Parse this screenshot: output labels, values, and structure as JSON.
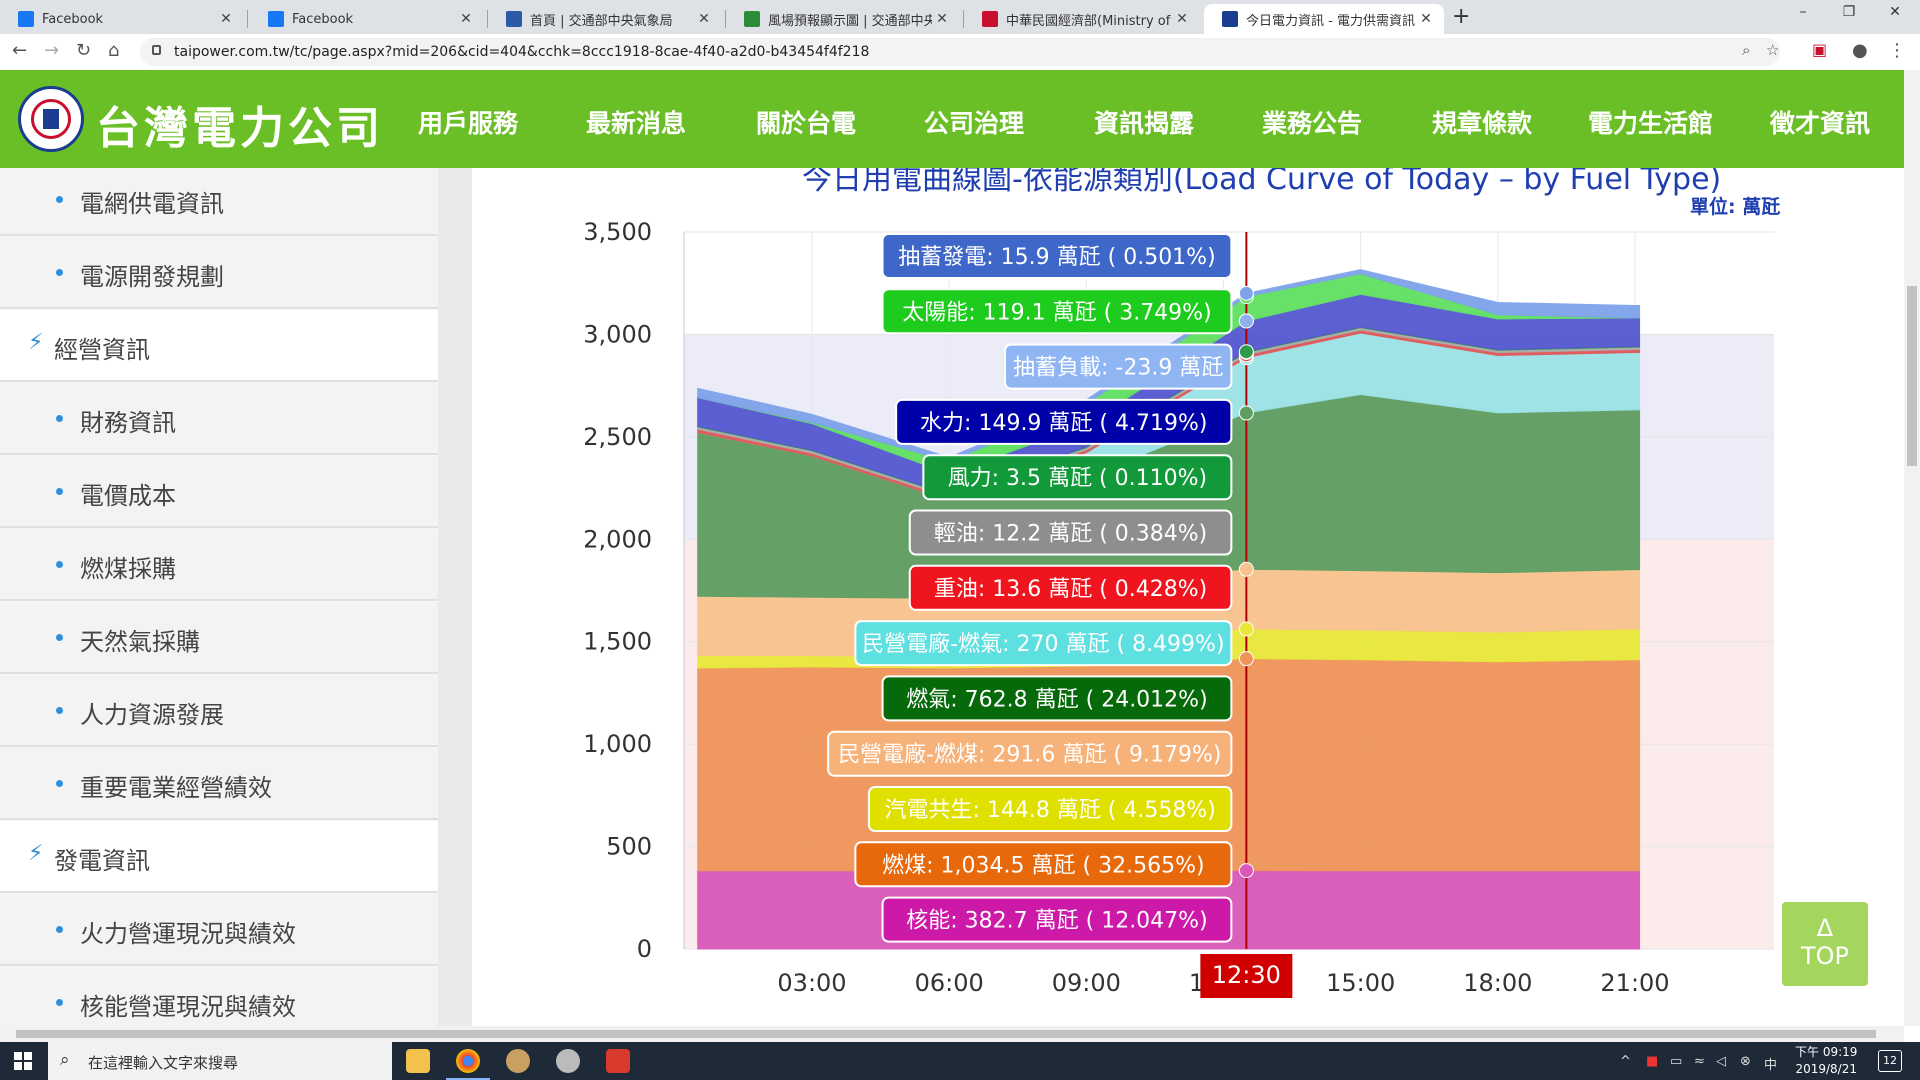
{
  "browser": {
    "tabs": [
      {
        "title": "Facebook",
        "icon": "facebook-icon",
        "color": "#1877f2"
      },
      {
        "title": "Facebook",
        "icon": "facebook-icon",
        "color": "#1877f2"
      },
      {
        "title": "首頁 | 交通部中央氣象局",
        "icon": "cwb-icon",
        "color": "#2b5aa6"
      },
      {
        "title": "風場預報顯示圖 | 交通部中央氣象",
        "icon": "map-icon",
        "color": "#2e8b3a"
      },
      {
        "title": "中華民國經濟部(Ministry of Econ",
        "icon": "moea-icon",
        "color": "#c8102e"
      },
      {
        "title": "今日電力資訊 - 電力供需資訊 - 台",
        "icon": "taipower-icon",
        "color": "#1a3d8f"
      }
    ],
    "new_tab": "+",
    "url": "taipower.com.tw/tc/page.aspx?mid=206&cid=404&cchk=8ccc1918-8cae-4f40-a2d0-b43454f4f218",
    "window_controls": {
      "minimize": "–",
      "maximize": "❐",
      "close": "✕"
    }
  },
  "site": {
    "company": "台灣電力公司",
    "nav": [
      "用戶服務",
      "最新消息",
      "關於台電",
      "公司治理",
      "資訊揭露",
      "業務公告",
      "規章條款",
      "電力生活館",
      "徵才資訊"
    ]
  },
  "sidebar": {
    "items": [
      {
        "label": "電網供電資訊",
        "type": "sub"
      },
      {
        "label": "電源開發規劃",
        "type": "sub"
      },
      {
        "label": "經營資訊",
        "type": "head"
      },
      {
        "label": "財務資訊",
        "type": "sub"
      },
      {
        "label": "電價成本",
        "type": "sub"
      },
      {
        "label": "燃煤採購",
        "type": "sub"
      },
      {
        "label": "天然氣採購",
        "type": "sub"
      },
      {
        "label": "人力資源發展",
        "type": "sub"
      },
      {
        "label": "重要電業經營績效",
        "type": "sub"
      },
      {
        "label": "發電資訊",
        "type": "head"
      },
      {
        "label": "火力營運現況與績效",
        "type": "sub"
      },
      {
        "label": "核能營運現況與績效",
        "type": "sub"
      }
    ]
  },
  "chart_data": {
    "type": "area",
    "title": "今日用電曲線圖-依能源類別(Load Curve of Today – by Fuel Type)",
    "unit_label": "單位: 萬瓩",
    "y_ticks": [
      "0",
      "500",
      "1,000",
      "1,500",
      "2,000",
      "2,500",
      "3,000",
      "3,500"
    ],
    "ylim": [
      0,
      3500
    ],
    "x_ticks": [
      "03:00",
      "06:00",
      "09:00",
      "12:00",
      "15:00",
      "18:00",
      "21:00"
    ],
    "xlim_hours": [
      0,
      24
    ],
    "cursor_time": "12:30",
    "stacked": true,
    "x_hours": [
      0.5,
      3,
      6,
      9,
      12.5,
      15,
      18,
      21,
      21.1
    ],
    "series": [
      {
        "name": "核能",
        "color": "#d958b8",
        "values": [
          382,
          382,
          382,
          382,
          382.7,
          382,
          382,
          382,
          382
        ]
      },
      {
        "name": "燃煤",
        "color": "#ef955a",
        "values": [
          990,
          995,
          990,
          1000,
          1034.5,
          1030,
          1020,
          1030,
          1030
        ]
      },
      {
        "name": "汽電共生",
        "color": "#e9e83a",
        "values": [
          60,
          55,
          55,
          130,
          144.8,
          145,
          145,
          150,
          150
        ]
      },
      {
        "name": "民營電廠-燃煤",
        "color": "#f8c38e",
        "values": [
          290,
          285,
          285,
          291,
          291.6,
          290,
          290,
          290,
          290
        ]
      },
      {
        "name": "燃氣",
        "color": "#5e9e60",
        "values": [
          800,
          690,
          480,
          500,
          762.8,
          860,
          780,
          780,
          780
        ]
      },
      {
        "name": "民營電廠-燃氣",
        "color": "#9be3e6",
        "values": [
          0,
          0,
          0,
          120,
          270,
          300,
          280,
          280,
          280
        ]
      },
      {
        "name": "重油",
        "color": "#e25555",
        "values": [
          15,
          13,
          13,
          13,
          13.6,
          14,
          14,
          14,
          14
        ]
      },
      {
        "name": "輕油",
        "color": "#aaaaaa",
        "values": [
          12,
          12,
          12,
          12,
          12.2,
          12,
          12,
          12,
          12
        ]
      },
      {
        "name": "風力",
        "color": "#2e9b4b",
        "values": [
          3,
          3,
          3,
          3,
          3.5,
          3,
          3,
          3,
          3
        ]
      },
      {
        "name": "水力",
        "color": "#5558cf",
        "values": [
          140,
          130,
          100,
          110,
          149.9,
          160,
          150,
          140,
          140
        ]
      },
      {
        "name": "抽蓄負載",
        "color": "#8fb0ef",
        "values": [
          0,
          0,
          0,
          0,
          0,
          0,
          0,
          0,
          0
        ]
      },
      {
        "name": "太陽能",
        "color": "#5fe05f",
        "values": [
          0,
          5,
          60,
          100,
          119.1,
          100,
          20,
          0,
          0
        ]
      },
      {
        "name": "抽蓄發電",
        "color": "#7ea3ea",
        "values": [
          45,
          40,
          20,
          20,
          15.9,
          20,
          60,
          60,
          60
        ]
      }
    ],
    "tooltip": [
      {
        "text": "抽蓄發電: 15.9 萬瓩 ( 0.501%)",
        "bg": "#3f67c9",
        "fg": "#ffffff"
      },
      {
        "text": "太陽能: 119.1 萬瓩 ( 3.749%)",
        "bg": "#1ecc1e",
        "fg": "#ffffff"
      },
      {
        "text": "抽蓄負載: -23.9 萬瓩",
        "bg": "#8fb6f3",
        "fg": "#ffffff"
      },
      {
        "text": "水力: 149.9 萬瓩 ( 4.719%)",
        "bg": "#0000a8",
        "fg": "#ffffff"
      },
      {
        "text": "風力: 3.5 萬瓩 ( 0.110%)",
        "bg": "#129a3a",
        "fg": "#ffffff"
      },
      {
        "text": "輕油: 12.2 萬瓩 ( 0.384%)",
        "bg": "#8e8e8e",
        "fg": "#ffffff"
      },
      {
        "text": "重油: 13.6 萬瓩 ( 0.428%)",
        "bg": "#f0141e",
        "fg": "#ffffff"
      },
      {
        "text": "民營電廠-燃氣: 270 萬瓩 ( 8.499%)",
        "bg": "#5fe0e0",
        "fg": "#ffffff"
      },
      {
        "text": "燃氣: 762.8 萬瓩 ( 24.012%)",
        "bg": "#066a0a",
        "fg": "#ffffff"
      },
      {
        "text": "民營電廠-燃煤: 291.6 萬瓩 ( 9.179%)",
        "bg": "#f7b27a",
        "fg": "#ffffff"
      },
      {
        "text": "汽電共生: 144.8 萬瓩 ( 4.558%)",
        "bg": "#e0e000",
        "fg": "#ffffff"
      },
      {
        "text": "燃煤: 1,034.5 萬瓩 ( 32.565%)",
        "bg": "#e8680c",
        "fg": "#ffffff"
      },
      {
        "text": "核能: 382.7 萬瓩 ( 12.047%)",
        "bg": "#cc19a8",
        "fg": "#ffffff"
      }
    ]
  },
  "top_button": {
    "arrow": "Δ",
    "label": "TOP"
  },
  "taskbar": {
    "search_placeholder": "在這裡輸入文字來搜尋",
    "time": "下午 09:19",
    "date": "2019/8/21",
    "notifications": "12"
  }
}
